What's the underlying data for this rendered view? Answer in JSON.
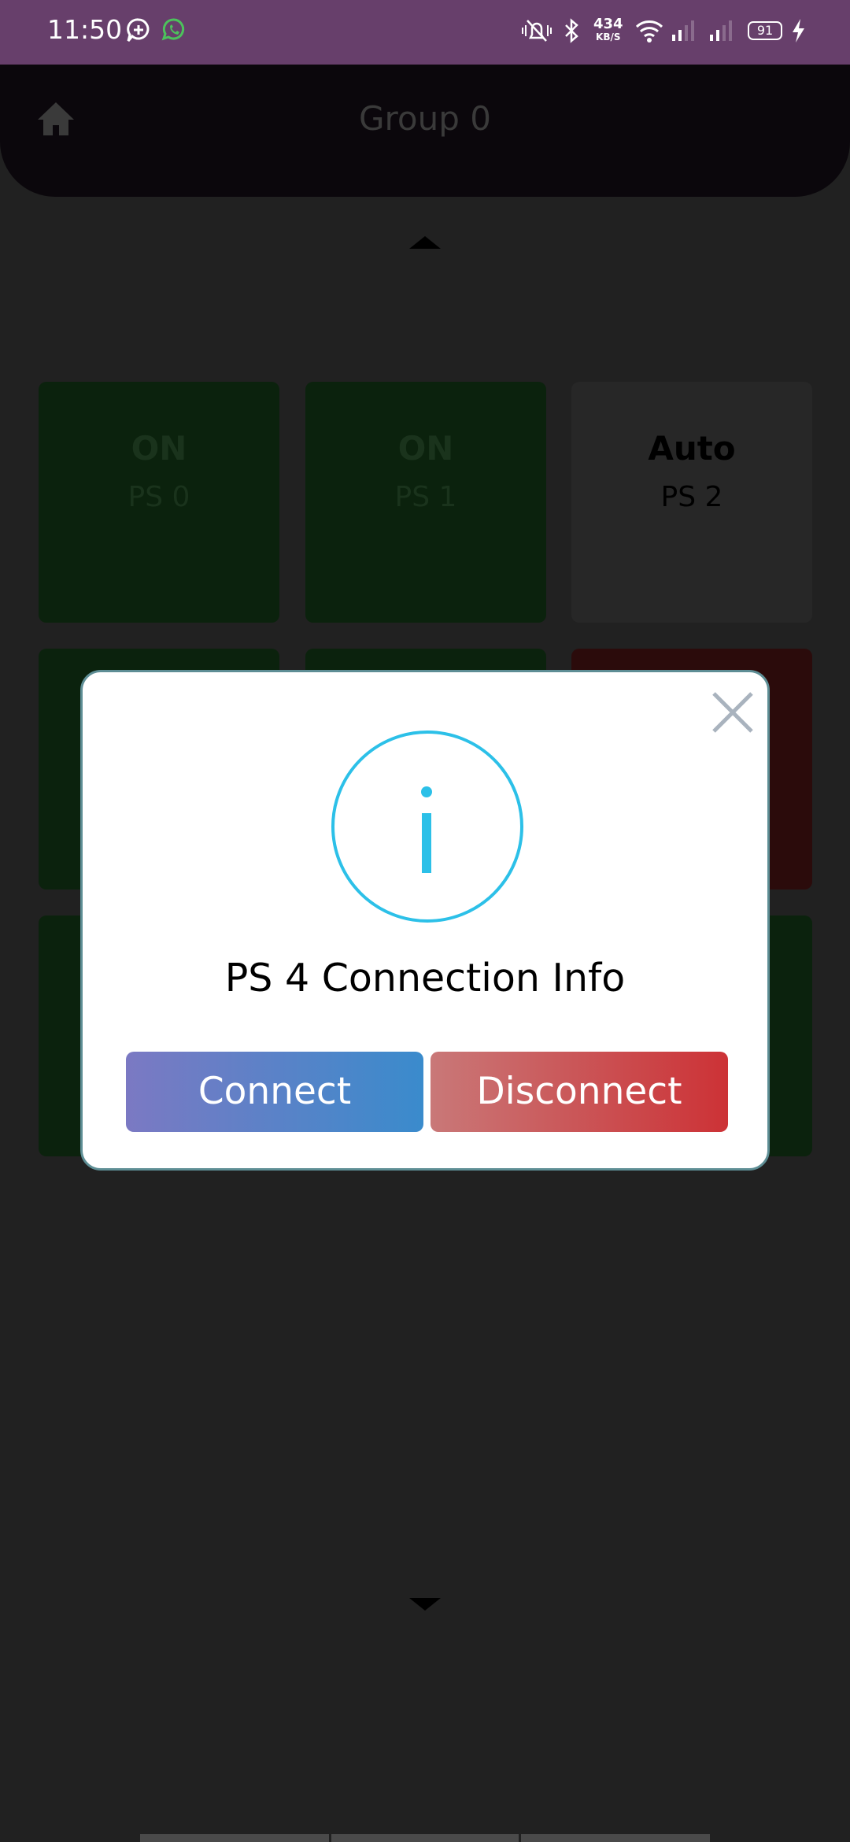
{
  "status_bar": {
    "time": "11:50",
    "network_speed": "434",
    "network_unit": "KB/S",
    "battery": "91",
    "icons": [
      "chat-bubble-icon",
      "whatsapp-icon",
      "vibrate-mute-icon",
      "bluetooth-icon",
      "wifi-icon",
      "signal-icon",
      "signal-icon",
      "charging-icon"
    ]
  },
  "header": {
    "title": "Group 0"
  },
  "tiles": [
    {
      "state": "ON",
      "name": "PS 0"
    },
    {
      "state": "ON",
      "name": "PS 1"
    },
    {
      "state": "Auto",
      "name": "PS 2"
    }
  ],
  "dialog": {
    "title": "PS 4 Connection Info",
    "connect_label": "Connect",
    "disconnect_label": "Disconnect"
  },
  "colors": {
    "status_bar": "#673f6b",
    "info_accent": "#2cc0e8",
    "connect_gradient": [
      "#7b79c3",
      "#3a8bcc"
    ],
    "disconnect_gradient": [
      "#c97878",
      "#cc3236"
    ]
  }
}
